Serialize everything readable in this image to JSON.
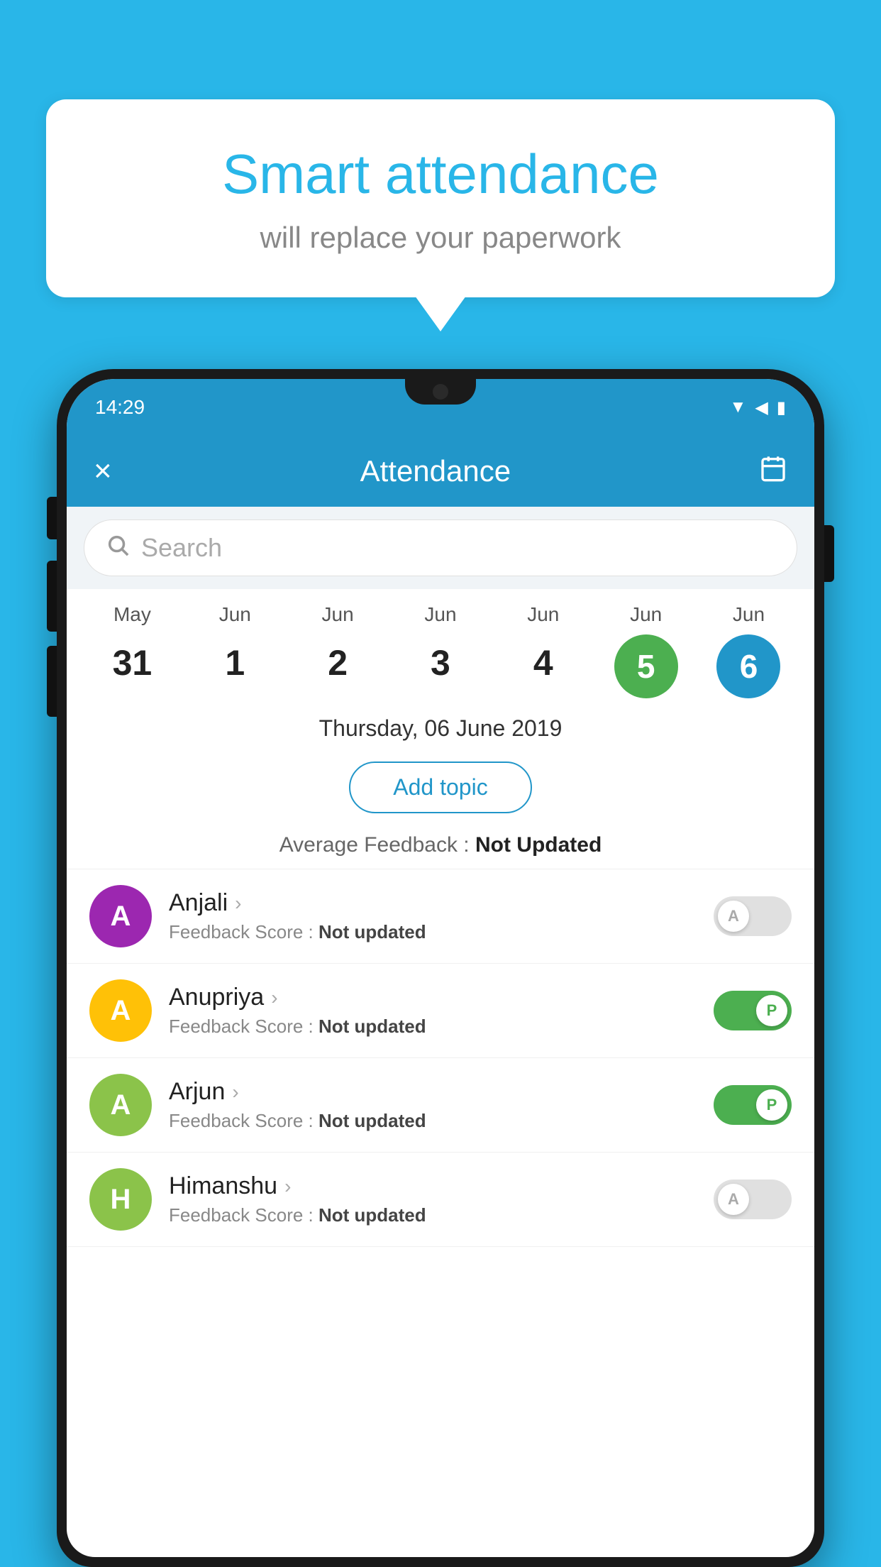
{
  "background_color": "#29B6E8",
  "speech_bubble": {
    "title": "Smart attendance",
    "subtitle": "will replace your paperwork"
  },
  "status_bar": {
    "time": "14:29",
    "icons": [
      "wifi",
      "signal",
      "battery"
    ]
  },
  "app_header": {
    "title": "Attendance",
    "close_label": "×",
    "calendar_icon": "📅"
  },
  "search": {
    "placeholder": "Search"
  },
  "calendar": {
    "days": [
      {
        "month": "May",
        "day": "31",
        "state": "normal"
      },
      {
        "month": "Jun",
        "day": "1",
        "state": "normal"
      },
      {
        "month": "Jun",
        "day": "2",
        "state": "normal"
      },
      {
        "month": "Jun",
        "day": "3",
        "state": "normal"
      },
      {
        "month": "Jun",
        "day": "4",
        "state": "normal"
      },
      {
        "month": "Jun",
        "day": "5",
        "state": "today"
      },
      {
        "month": "Jun",
        "day": "6",
        "state": "selected"
      }
    ]
  },
  "selected_date": "Thursday, 06 June 2019",
  "add_topic_label": "Add topic",
  "average_feedback": {
    "label": "Average Feedback : ",
    "value": "Not Updated"
  },
  "students": [
    {
      "name": "Anjali",
      "avatar_letter": "A",
      "avatar_color": "#9C27B0",
      "feedback": "Not updated",
      "toggle_state": "off",
      "toggle_label": "A"
    },
    {
      "name": "Anupriya",
      "avatar_letter": "A",
      "avatar_color": "#FFC107",
      "feedback": "Not updated",
      "toggle_state": "on",
      "toggle_label": "P"
    },
    {
      "name": "Arjun",
      "avatar_letter": "A",
      "avatar_color": "#8BC34A",
      "feedback": "Not updated",
      "toggle_state": "on",
      "toggle_label": "P"
    },
    {
      "name": "Himanshu",
      "avatar_letter": "H",
      "avatar_color": "#8BC34A",
      "feedback": "Not updated",
      "toggle_state": "off",
      "toggle_label": "A"
    }
  ],
  "feedback_score_label": "Feedback Score : "
}
